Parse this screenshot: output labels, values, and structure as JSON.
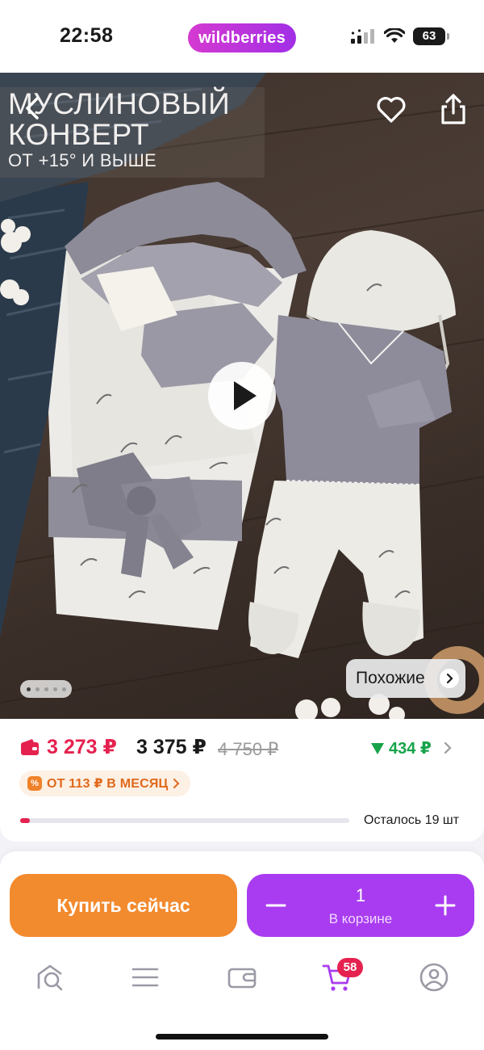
{
  "status_bar": {
    "time": "22:58",
    "brand": "wildberries",
    "battery": "63"
  },
  "product_image": {
    "title_line1": "МУСЛИНОВЫЙ",
    "title_line2": "КОНВЕРТ",
    "subtitle": "ОТ +15° И ВЫШЕ",
    "similar_label": "Похожие",
    "gallery_dots": 5,
    "active_dot": 0
  },
  "price": {
    "wallet_price": "3 273 ₽",
    "price": "3 375 ₽",
    "old_price": "4 750 ₽",
    "cashback": "434 ₽",
    "installment": "ОТ 113 ₽ В МЕСЯЦ",
    "stock_text": "Осталось 19 шт",
    "stock_fraction": 0.03
  },
  "actions": {
    "buy_now": "Купить сейчас",
    "quantity": "1",
    "in_cart_label": "В корзине"
  },
  "tab_bar": {
    "cart_badge": "58"
  },
  "colors": {
    "brand": "#a93cf0",
    "price_red": "#e5224f",
    "cashback_green": "#16a34a",
    "buy_orange": "#f28a2e"
  }
}
